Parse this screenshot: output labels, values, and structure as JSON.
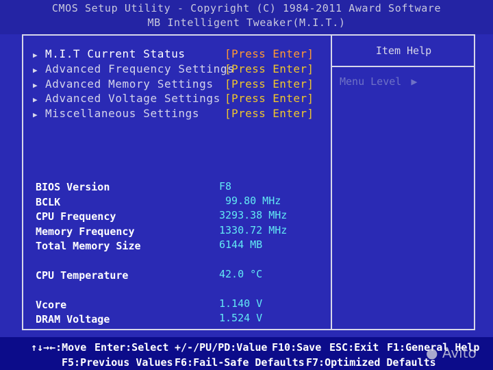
{
  "header": {
    "title": "CMOS Setup Utility - Copyright (C) 1984-2011 Award Software",
    "subtitle": "MB Intelligent Tweaker(M.I.T.)"
  },
  "menu": [
    {
      "label": "M.I.T Current Status",
      "action": "[Press Enter]",
      "selected": true
    },
    {
      "label": "Advanced Frequency Settings",
      "action": "[Press Enter]",
      "selected": false
    },
    {
      "label": "Advanced Memory Settings",
      "action": "[Press Enter]",
      "selected": false
    },
    {
      "label": "Advanced Voltage Settings",
      "action": "[Press Enter]",
      "selected": false
    },
    {
      "label": "Miscellaneous Settings",
      "action": "[Press Enter]",
      "selected": false
    }
  ],
  "info": [
    {
      "label": "BIOS Version",
      "value": "F8"
    },
    {
      "label": "BCLK",
      "value": "99.80 MHz"
    },
    {
      "label": "CPU Frequency",
      "value": "3293.38 MHz"
    },
    {
      "label": "Memory Frequency",
      "value": "1330.72 MHz"
    },
    {
      "label": "Total Memory Size",
      "value": "6144 MB"
    },
    {
      "label": "CPU Temperature",
      "value": "42.0 °C"
    },
    {
      "label": "Vcore",
      "value": "1.140 V"
    },
    {
      "label": "DRAM Voltage",
      "value": "1.524 V"
    }
  ],
  "help": {
    "title": "Item Help",
    "menu_level": "Menu Level",
    "menu_level_arrow": "▶"
  },
  "footer": {
    "move": "↑↓→←:Move",
    "select": "Enter:Select",
    "value": "+/-/PU/PD:Value",
    "save": "F10:Save",
    "exit": "ESC:Exit",
    "help": "F1:General Help",
    "previous": "F5:Previous Values",
    "failsafe": "F6:Fail-Safe Defaults",
    "optimized": "F7:Optimized Defaults"
  },
  "watermark": "Avito",
  "colors": {
    "background": "#2a2ab4",
    "label": "#ffffff",
    "value": "#62e8f4",
    "press_enter": "#f0c62c",
    "footer_bg": "#0c0c8a"
  }
}
